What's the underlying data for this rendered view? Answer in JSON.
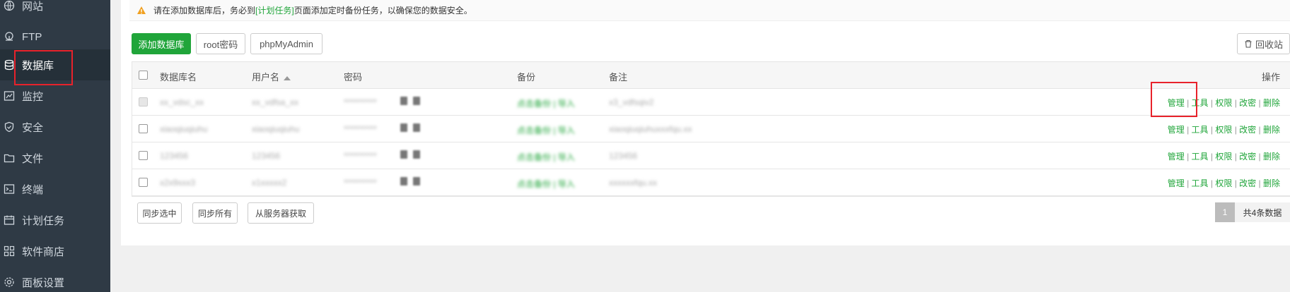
{
  "sidebar": {
    "items": [
      {
        "label": "网站",
        "icon": "globe-icon"
      },
      {
        "label": "FTP",
        "icon": "ftp-icon"
      },
      {
        "label": "数据库",
        "icon": "database-icon",
        "active": true
      },
      {
        "label": "监控",
        "icon": "monitor-icon"
      },
      {
        "label": "安全",
        "icon": "shield-icon"
      },
      {
        "label": "文件",
        "icon": "folder-icon"
      },
      {
        "label": "终端",
        "icon": "terminal-icon"
      },
      {
        "label": "计划任务",
        "icon": "calendar-icon"
      },
      {
        "label": "软件商店",
        "icon": "apps-icon"
      },
      {
        "label": "面板设置",
        "icon": "gear-icon"
      }
    ]
  },
  "notice": {
    "before": "请在添加数据库后，务必到",
    "link": "[计划任务]",
    "after": "页面添加定时备份任务，以确保您的数据安全。"
  },
  "toolbar": {
    "add_db": "添加数据库",
    "root_pwd": "root密码",
    "phpmyadmin": "phpMyAdmin",
    "recycle": "回收站"
  },
  "table": {
    "headers": {
      "name": "数据库名",
      "user": "用户名",
      "password": "密码",
      "backup": "备份",
      "note": "备注",
      "ops": "操作"
    },
    "rows": [
      {
        "name": "xx_vdsc_xx",
        "user": "xx_vdfsa_xx",
        "password": "**********",
        "backup": "点击备份 | 导入",
        "note": "x3_vdfsqiv2"
      },
      {
        "name": "xiaoqiuqiuhu",
        "user": "xiaoqiuqiuhu",
        "password": "**********",
        "backup": "点击备份 | 导入",
        "note": "xiaoqiuqiuhuxxxfqu.xx"
      },
      {
        "name": "123456",
        "user": "123456",
        "password": "**********",
        "backup": "点击备份 | 导入",
        "note": "123456"
      },
      {
        "name": "x2x9xxx3",
        "user": "x1xxxxx2",
        "password": "**********",
        "backup": "点击备份 | 导入",
        "note": "xxxxxxfqu.xx"
      }
    ],
    "ops": [
      "管理",
      "工具",
      "权限",
      "改密",
      "删除"
    ]
  },
  "footer": {
    "sync_selected": "同步选中",
    "sync_all": "同步所有",
    "fetch_server": "从服务器获取",
    "page": "1",
    "total": "共4条数据"
  },
  "colors": {
    "sidebar_bg": "#2f3a45",
    "accent": "#20a53a",
    "highlight": "#e8222b"
  }
}
